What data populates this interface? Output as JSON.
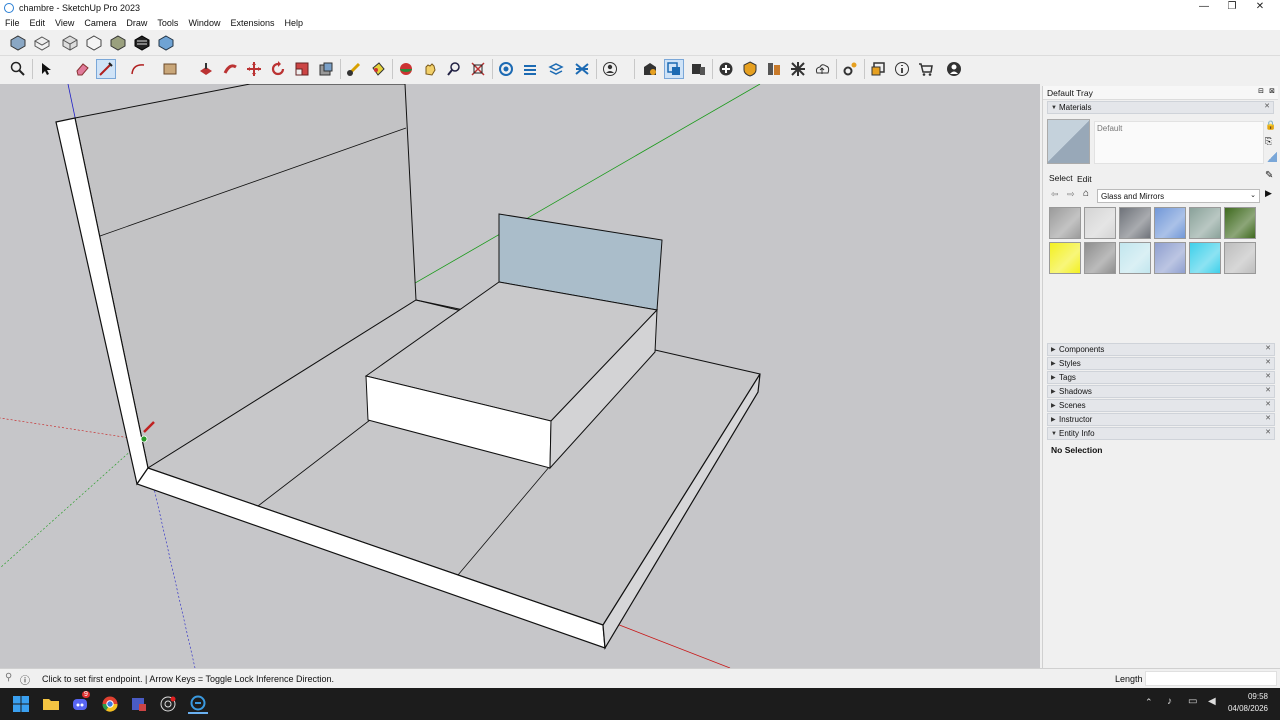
{
  "window": {
    "title": "chambre - SketchUp Pro 2023",
    "controls": [
      "—",
      "❐",
      "✕"
    ]
  },
  "menu": [
    "File",
    "Edit",
    "View",
    "Camera",
    "Draw",
    "Tools",
    "Window",
    "Extensions",
    "Help"
  ],
  "toolbar_row1": [
    "iso-view-icon",
    "top-view-icon",
    "front-view-icon",
    "right-view-icon",
    "back-view-icon",
    "left-view-icon",
    "bottom-view-icon"
  ],
  "toolbar_row2": [
    "zoom-icon",
    "select-icon",
    "eraser-icon",
    "line-icon",
    "arc-icon",
    "shape-icon",
    "push-pull-icon",
    "follow-me-icon",
    "move-icon",
    "rotate-icon",
    "scale-icon",
    "offset-icon",
    "tape-measure-icon",
    "paint-bucket-icon",
    "orbit-icon",
    "pan-icon",
    "zoom-window-icon",
    "zoom-extents-icon",
    "sandbox-icon",
    "section-plane-icon",
    "section-fill-icon",
    "section-cuts-icon",
    "account-icon",
    "warehouse-icon",
    "extension-manager-icon",
    "layout-icon",
    "add-location-icon",
    "solar-icon",
    "style-builder-icon",
    "photo-textures-icon",
    "upload-icon",
    "settings-icon",
    "scenes-icon",
    "info-icon",
    "extension-warehouse-icon",
    "profile-icon"
  ],
  "tray": {
    "title": "Default Tray",
    "materials": {
      "header": "Materials",
      "current": "Default",
      "tab_select": "Select",
      "tab_edit": "Edit",
      "collection": "Glass and Mirrors",
      "swatches": [
        "#9b9b9b",
        "#d4d4d4",
        "#6f737a",
        "#7298d8",
        "#8aa29a",
        "#3f6a1e",
        "#f3f021",
        "#8e8e8e",
        "#c2e6ee",
        "#8f9fcf",
        "#3fd0ea",
        "#bdbdbd"
      ]
    },
    "panels": [
      "Components",
      "Styles",
      "Tags",
      "Shadows",
      "Scenes",
      "Instructor",
      "Entity Info"
    ],
    "entity_info": "No Selection"
  },
  "status": {
    "message": "Click to set first endpoint. | Arrow Keys = Toggle Lock Inference Direction.",
    "measurement_label": "Length",
    "measurement_value": ""
  },
  "taskbar": {
    "time": "09:58",
    "date": "04/08/2026",
    "apps": [
      "windows-start-icon",
      "file-explorer-icon",
      "discord-icon",
      "chrome-icon",
      "teams-icon",
      "obs-icon",
      "sketchup-icon"
    ],
    "discord_badge": "9"
  },
  "colors": {
    "viewport_bg": "#c6c6c9",
    "face_light": "#ffffff",
    "face_grey": "#c9c9c9",
    "glass": "#a9bdc9",
    "axis_red": "#d02020",
    "axis_green": "#20a020",
    "axis_blue": "#2020d0"
  }
}
